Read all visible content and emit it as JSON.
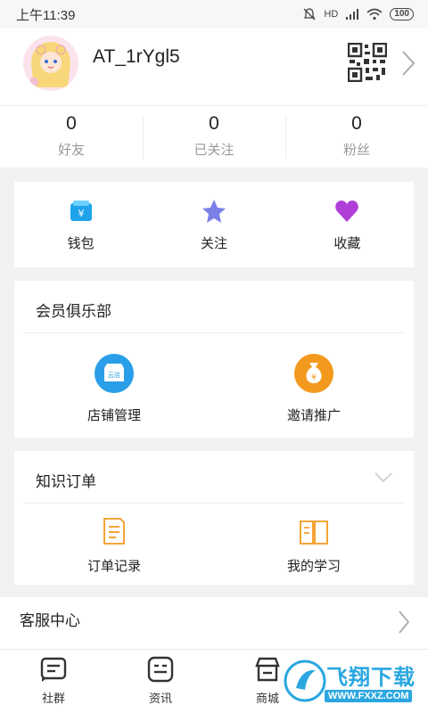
{
  "status_bar": {
    "time": "上午11:39",
    "network": "HD",
    "battery": "100"
  },
  "profile": {
    "username": "AT_1rYgl5"
  },
  "stats": [
    {
      "value": "0",
      "label": "好友"
    },
    {
      "value": "0",
      "label": "已关注"
    },
    {
      "value": "0",
      "label": "粉丝"
    }
  ],
  "quick_actions": [
    {
      "label": "钱包",
      "icon": "wallet-icon"
    },
    {
      "label": "关注",
      "icon": "star-icon"
    },
    {
      "label": "收藏",
      "icon": "heart-icon"
    }
  ],
  "member_club": {
    "title": "会员俱乐部",
    "items": [
      {
        "label": "店铺管理",
        "icon": "store-icon",
        "icon_text": "云店"
      },
      {
        "label": "邀请推广",
        "icon": "money-bag-icon"
      }
    ]
  },
  "knowledge_orders": {
    "title": "知识订单",
    "items": [
      {
        "label": "订单记录",
        "icon": "order-record-icon"
      },
      {
        "label": "我的学习",
        "icon": "book-icon"
      }
    ]
  },
  "more_row": {
    "label": "客服中心"
  },
  "tabbar": [
    {
      "label": "社群",
      "icon": "community-icon"
    },
    {
      "label": "资讯",
      "icon": "news-icon"
    },
    {
      "label": "商城",
      "icon": "mall-icon"
    }
  ],
  "watermark": {
    "title": "飞翔下载",
    "url": "WWW.FXXZ.COM"
  },
  "colors": {
    "accent_blue": "#2a9ee8",
    "accent_orange": "#f39a1e",
    "star_purple": "#7b7fe8",
    "heart_purple": "#b03fd8"
  }
}
